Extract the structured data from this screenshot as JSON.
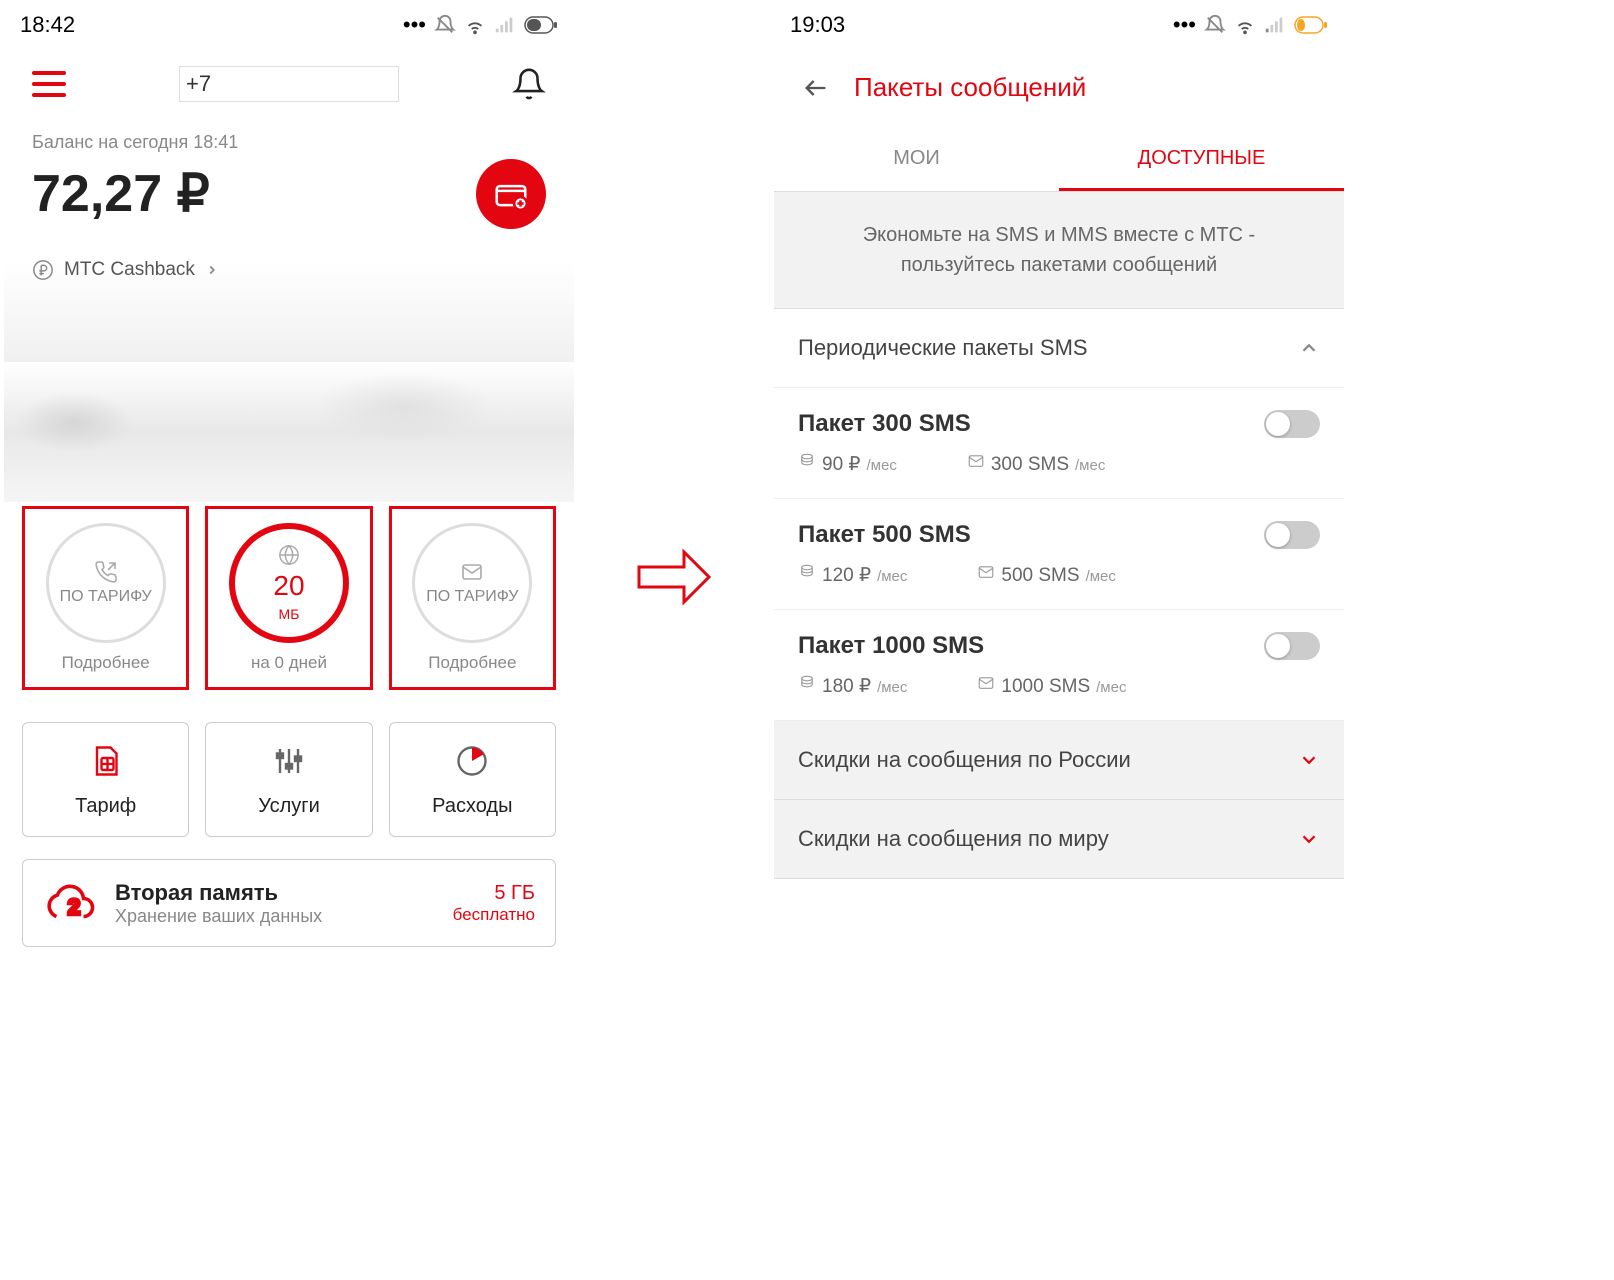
{
  "screen1": {
    "status_time": "18:42",
    "phone_prefix": "+7",
    "balance_label": "Баланс на сегодня 18:41",
    "balance_value": "72,27 ₽",
    "cashback_label": "МТС Cashback",
    "usage": [
      {
        "type_label": "ПО ТАРИФУ",
        "sub": "Подробнее"
      },
      {
        "value": "20",
        "unit": "МБ",
        "sub": "на 0 дней"
      },
      {
        "type_label": "ПО ТАРИФУ",
        "sub": "Подробнее"
      }
    ],
    "actions": [
      {
        "label": "Тариф"
      },
      {
        "label": "Услуги"
      },
      {
        "label": "Расходы"
      }
    ],
    "storage": {
      "title": "Вторая память",
      "sub": "Хранение ваших данных",
      "size": "5 ГБ",
      "free": "бесплатно"
    }
  },
  "screen2": {
    "status_time": "19:03",
    "page_title": "Пакеты сообщений",
    "tabs": {
      "mine": "МОИ",
      "available": "ДОСТУПНЫЕ"
    },
    "promo": "Экономьте на SMS и MMS вместе с МТС - пользуйтесь пакетами сообщений",
    "section_periodic": "Периодические пакеты SMS",
    "packages": [
      {
        "name": "Пакет 300 SMS",
        "price": "90 ₽",
        "qty": "300 SMS"
      },
      {
        "name": "Пакет 500 SMS",
        "price": "120 ₽",
        "qty": "500 SMS"
      },
      {
        "name": "Пакет 1000 SMS",
        "price": "180 ₽",
        "qty": "1000 SMS"
      }
    ],
    "unit_per_month": "/мес",
    "section_russia": "Скидки на сообщения по России",
    "section_world": "Скидки на сообщения по миру"
  }
}
